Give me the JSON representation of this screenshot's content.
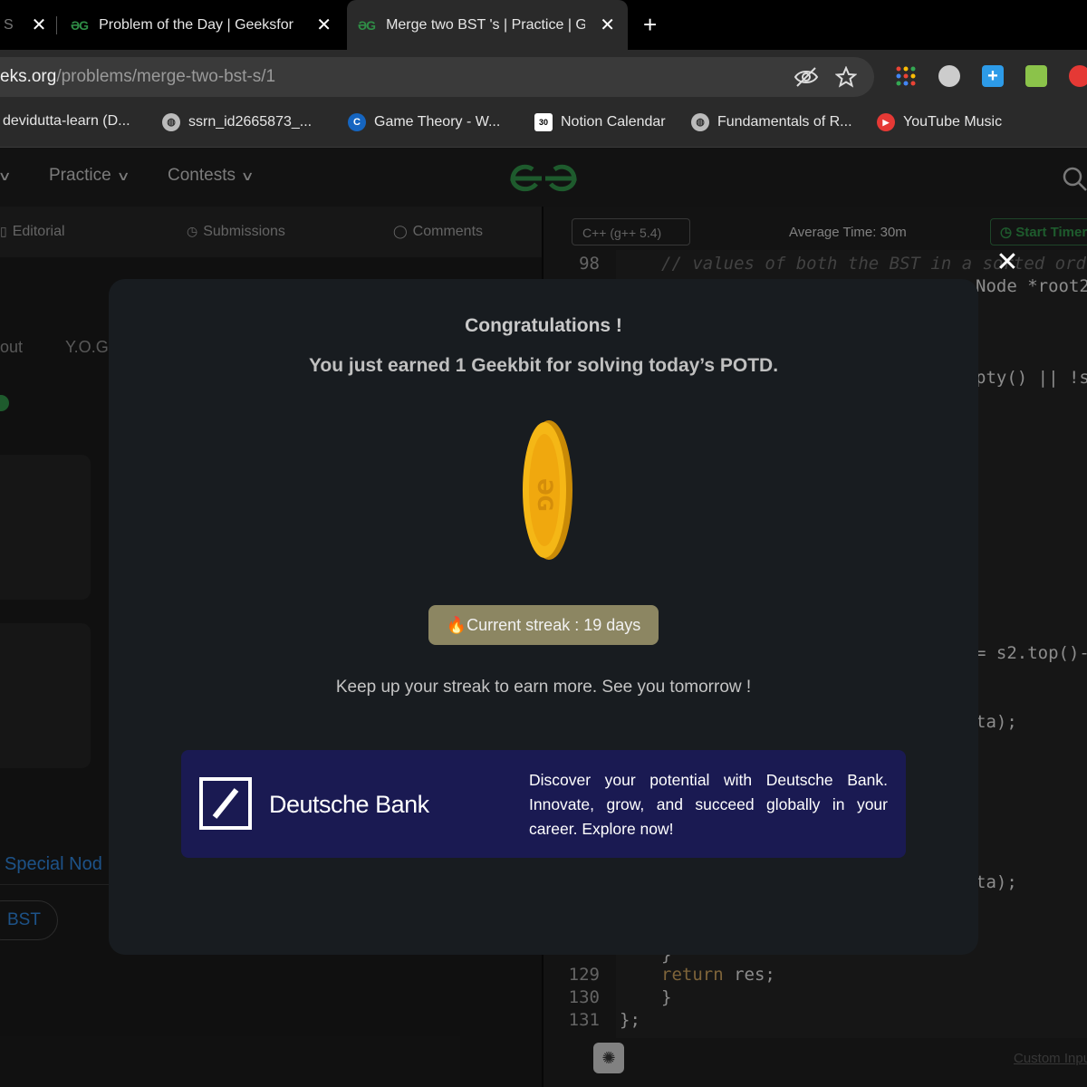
{
  "browser": {
    "tabs": [
      {
        "title": "S",
        "active": false
      },
      {
        "title": "Problem of the Day | Geeksfor",
        "active": false
      },
      {
        "title": "Merge two BST 's | Practice | G",
        "active": true
      }
    ],
    "new_tab_label": "+",
    "url_host": "eks.org",
    "url_path": "/problems/merge-two-bst-s/1",
    "bookmarks": [
      {
        "label": "devidutta-learn (D..."
      },
      {
        "label": "ssrn_id2665873_..."
      },
      {
        "label": "Game Theory - W..."
      },
      {
        "label": "Notion Calendar"
      },
      {
        "label": "Fundamentals of R..."
      },
      {
        "label": "YouTube Music"
      }
    ]
  },
  "site_nav": {
    "practice": "Practice",
    "contests": "Contests"
  },
  "left_panel": {
    "tabs": [
      "Editorial",
      "Submissions",
      "Comments"
    ],
    "fragments": {
      "about": "out",
      "yog": "Y.O.G",
      "special_node": "Special Nod",
      "bst_tag": "BST"
    }
  },
  "editor": {
    "language": "C++ (g++ 5.4)",
    "avg_time": "Average Time: 30m",
    "start_timer": "Start Timer",
    "lines": [
      {
        "n": "98",
        "code": "// values of both the BST in a sorted order"
      },
      {
        "n": "129",
        "code": "return res;"
      },
      {
        "n": "130",
        "code": "}"
      },
      {
        "n": "131",
        "code": "};"
      }
    ],
    "partial_code": {
      "node_root2": "Node *root2",
      "empty_check": "pty() || !s",
      "s2_top": "= s2.top()-",
      "ta1": "ta);",
      "ta2": "ta);",
      "line_128": "}"
    },
    "custom_input": "Custom Input"
  },
  "modal": {
    "title": "Congratulations !",
    "subtitle": "You just earned 1 Geekbit for solving today’s POTD.",
    "streak": "🔥Current streak : 19 days",
    "keep_up": "Keep up your streak to earn more. See you tomorrow !",
    "ad": {
      "brand": "Deutsche Bank",
      "text": "Discover your potential with Deutsche Bank. Innovate, grow, and succeed globally in your career. Explore now!",
      "background": "#1a1a52"
    },
    "close_label": "✕"
  },
  "colors": {
    "gfg_green": "#2f8d46",
    "streak_bg": "#8c8662",
    "modal_bg": "#181c20"
  }
}
